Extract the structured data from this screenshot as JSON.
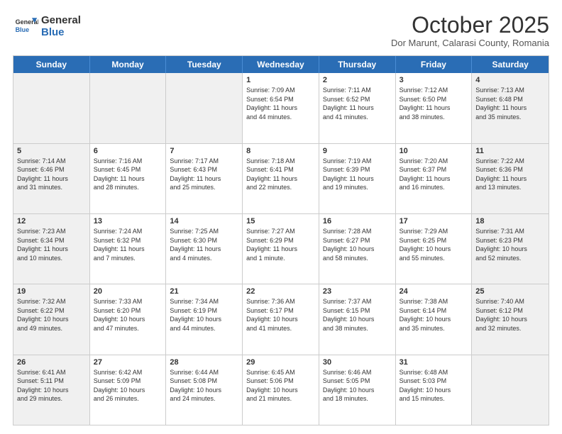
{
  "header": {
    "logo_general": "General",
    "logo_blue": "Blue",
    "month_title": "October 2025",
    "subtitle": "Dor Marunt, Calarasi County, Romania"
  },
  "days_of_week": [
    "Sunday",
    "Monday",
    "Tuesday",
    "Wednesday",
    "Thursday",
    "Friday",
    "Saturday"
  ],
  "weeks": [
    [
      {
        "day": "",
        "info": "",
        "shaded": true
      },
      {
        "day": "",
        "info": "",
        "shaded": true
      },
      {
        "day": "",
        "info": "",
        "shaded": true
      },
      {
        "day": "1",
        "info": "Sunrise: 7:09 AM\nSunset: 6:54 PM\nDaylight: 11 hours\nand 44 minutes."
      },
      {
        "day": "2",
        "info": "Sunrise: 7:11 AM\nSunset: 6:52 PM\nDaylight: 11 hours\nand 41 minutes."
      },
      {
        "day": "3",
        "info": "Sunrise: 7:12 AM\nSunset: 6:50 PM\nDaylight: 11 hours\nand 38 minutes."
      },
      {
        "day": "4",
        "info": "Sunrise: 7:13 AM\nSunset: 6:48 PM\nDaylight: 11 hours\nand 35 minutes.",
        "shaded": true
      }
    ],
    [
      {
        "day": "5",
        "info": "Sunrise: 7:14 AM\nSunset: 6:46 PM\nDaylight: 11 hours\nand 31 minutes.",
        "shaded": true
      },
      {
        "day": "6",
        "info": "Sunrise: 7:16 AM\nSunset: 6:45 PM\nDaylight: 11 hours\nand 28 minutes."
      },
      {
        "day": "7",
        "info": "Sunrise: 7:17 AM\nSunset: 6:43 PM\nDaylight: 11 hours\nand 25 minutes."
      },
      {
        "day": "8",
        "info": "Sunrise: 7:18 AM\nSunset: 6:41 PM\nDaylight: 11 hours\nand 22 minutes."
      },
      {
        "day": "9",
        "info": "Sunrise: 7:19 AM\nSunset: 6:39 PM\nDaylight: 11 hours\nand 19 minutes."
      },
      {
        "day": "10",
        "info": "Sunrise: 7:20 AM\nSunset: 6:37 PM\nDaylight: 11 hours\nand 16 minutes."
      },
      {
        "day": "11",
        "info": "Sunrise: 7:22 AM\nSunset: 6:36 PM\nDaylight: 11 hours\nand 13 minutes.",
        "shaded": true
      }
    ],
    [
      {
        "day": "12",
        "info": "Sunrise: 7:23 AM\nSunset: 6:34 PM\nDaylight: 11 hours\nand 10 minutes.",
        "shaded": true
      },
      {
        "day": "13",
        "info": "Sunrise: 7:24 AM\nSunset: 6:32 PM\nDaylight: 11 hours\nand 7 minutes."
      },
      {
        "day": "14",
        "info": "Sunrise: 7:25 AM\nSunset: 6:30 PM\nDaylight: 11 hours\nand 4 minutes."
      },
      {
        "day": "15",
        "info": "Sunrise: 7:27 AM\nSunset: 6:29 PM\nDaylight: 11 hours\nand 1 minute."
      },
      {
        "day": "16",
        "info": "Sunrise: 7:28 AM\nSunset: 6:27 PM\nDaylight: 10 hours\nand 58 minutes."
      },
      {
        "day": "17",
        "info": "Sunrise: 7:29 AM\nSunset: 6:25 PM\nDaylight: 10 hours\nand 55 minutes."
      },
      {
        "day": "18",
        "info": "Sunrise: 7:31 AM\nSunset: 6:23 PM\nDaylight: 10 hours\nand 52 minutes.",
        "shaded": true
      }
    ],
    [
      {
        "day": "19",
        "info": "Sunrise: 7:32 AM\nSunset: 6:22 PM\nDaylight: 10 hours\nand 49 minutes.",
        "shaded": true
      },
      {
        "day": "20",
        "info": "Sunrise: 7:33 AM\nSunset: 6:20 PM\nDaylight: 10 hours\nand 47 minutes."
      },
      {
        "day": "21",
        "info": "Sunrise: 7:34 AM\nSunset: 6:19 PM\nDaylight: 10 hours\nand 44 minutes."
      },
      {
        "day": "22",
        "info": "Sunrise: 7:36 AM\nSunset: 6:17 PM\nDaylight: 10 hours\nand 41 minutes."
      },
      {
        "day": "23",
        "info": "Sunrise: 7:37 AM\nSunset: 6:15 PM\nDaylight: 10 hours\nand 38 minutes."
      },
      {
        "day": "24",
        "info": "Sunrise: 7:38 AM\nSunset: 6:14 PM\nDaylight: 10 hours\nand 35 minutes."
      },
      {
        "day": "25",
        "info": "Sunrise: 7:40 AM\nSunset: 6:12 PM\nDaylight: 10 hours\nand 32 minutes.",
        "shaded": true
      }
    ],
    [
      {
        "day": "26",
        "info": "Sunrise: 6:41 AM\nSunset: 5:11 PM\nDaylight: 10 hours\nand 29 minutes.",
        "shaded": true
      },
      {
        "day": "27",
        "info": "Sunrise: 6:42 AM\nSunset: 5:09 PM\nDaylight: 10 hours\nand 26 minutes."
      },
      {
        "day": "28",
        "info": "Sunrise: 6:44 AM\nSunset: 5:08 PM\nDaylight: 10 hours\nand 24 minutes."
      },
      {
        "day": "29",
        "info": "Sunrise: 6:45 AM\nSunset: 5:06 PM\nDaylight: 10 hours\nand 21 minutes."
      },
      {
        "day": "30",
        "info": "Sunrise: 6:46 AM\nSunset: 5:05 PM\nDaylight: 10 hours\nand 18 minutes."
      },
      {
        "day": "31",
        "info": "Sunrise: 6:48 AM\nSunset: 5:03 PM\nDaylight: 10 hours\nand 15 minutes."
      },
      {
        "day": "",
        "info": "",
        "shaded": true
      }
    ]
  ]
}
